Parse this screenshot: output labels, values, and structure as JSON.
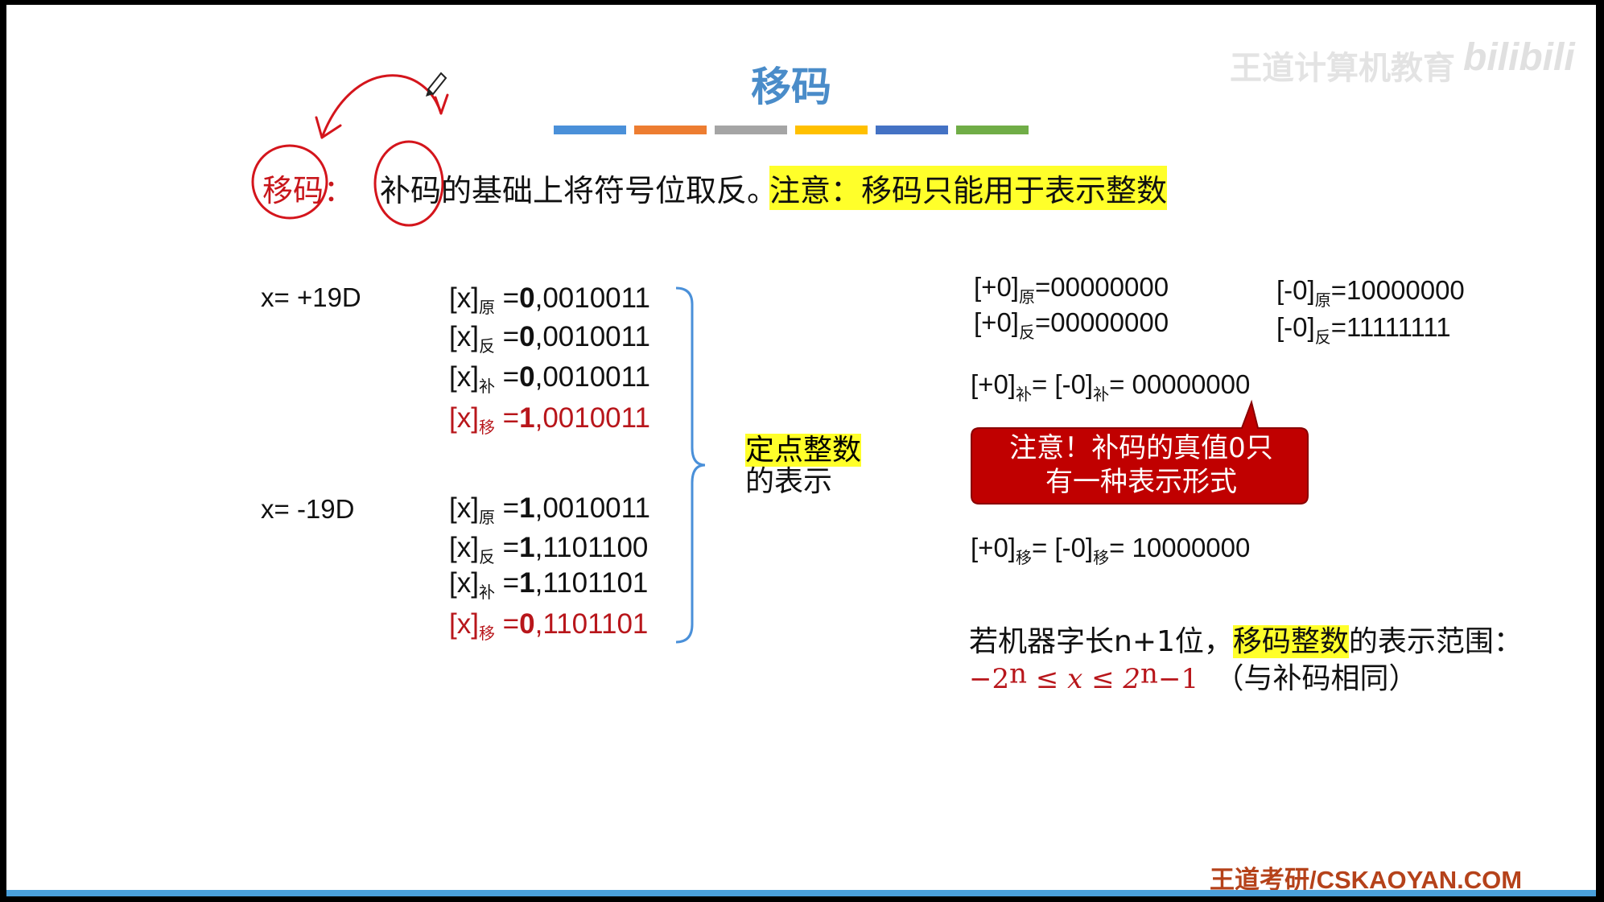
{
  "title": "移码",
  "watermark": {
    "text": "王道计算机教育",
    "brand": "bilibili"
  },
  "color_bars": [
    "#4a90d9",
    "#ed7d31",
    "#a5a5a5",
    "#ffc000",
    "#4472c4",
    "#70ad47"
  ],
  "definition": {
    "label": "移码：",
    "text": "补码的基础上将符号位取反。",
    "note": "注意：移码只能用于表示整数"
  },
  "pos": {
    "x_label": "x= +19D",
    "rows": [
      {
        "sub": "原",
        "eq": " =",
        "bit": "0",
        "rest": ",0010011",
        "red": false
      },
      {
        "sub": "反",
        "eq": " =",
        "bit": "0",
        "rest": ",0010011",
        "red": false
      },
      {
        "sub": "补",
        "eq": " =",
        "bit": "0",
        "rest": ",0010011",
        "red": false
      },
      {
        "sub": "移",
        "eq": " =",
        "bit": "1",
        "rest": ",0010011",
        "red": true
      }
    ]
  },
  "neg": {
    "x_label": "x= -19D",
    "rows": [
      {
        "sub": "原",
        "eq": " =",
        "bit": "1",
        "rest": ",0010011",
        "red": false
      },
      {
        "sub": "反",
        "eq": " =",
        "bit": "1",
        "rest": ",1101100",
        "red": false
      },
      {
        "sub": "补",
        "eq": " =",
        "bit": "1",
        "rest": ",1101101",
        "red": false
      },
      {
        "sub": "移",
        "eq": " =",
        "bit": "0",
        "rest": ",1101101",
        "red": true
      }
    ]
  },
  "brace_label": {
    "line1": "定点整数",
    "line2": "的表示"
  },
  "zero": {
    "pos_orig": {
      "pre": "[+0]",
      "sub": "原",
      "val": "=00000000"
    },
    "pos_ones": {
      "pre": "[+0]",
      "sub": "反",
      "val": "=00000000"
    },
    "neg_orig": {
      "pre": "[-0]",
      "sub": "原",
      "val": "=10000000"
    },
    "neg_ones": {
      "pre": "[-0]",
      "sub": "反",
      "val": "=11111111"
    },
    "twos": {
      "a": "[+0]",
      "a_sub": "补",
      "mid": "= [-0]",
      "b_sub": "补",
      "val": "= 00000000"
    },
    "bias": {
      "a": "[+0]",
      "a_sub": "移",
      "mid": "= [-0]",
      "b_sub": "移",
      "val": "= 10000000"
    }
  },
  "callout": {
    "line1": "注意！补码的真值0只",
    "line2": "有一种表示形式",
    "color": "#c00000"
  },
  "range": {
    "text_pre": "若机器字长n+1位，",
    "highlight": "移码整数",
    "text_post": "的表示范围：",
    "lower": "−2",
    "exp": "n",
    "mid": " ≤ x ≤ 2",
    "upper_tail": "−1",
    "note": "（与补码相同）"
  },
  "footer": "王道考研/CSKAOYAN.COM"
}
